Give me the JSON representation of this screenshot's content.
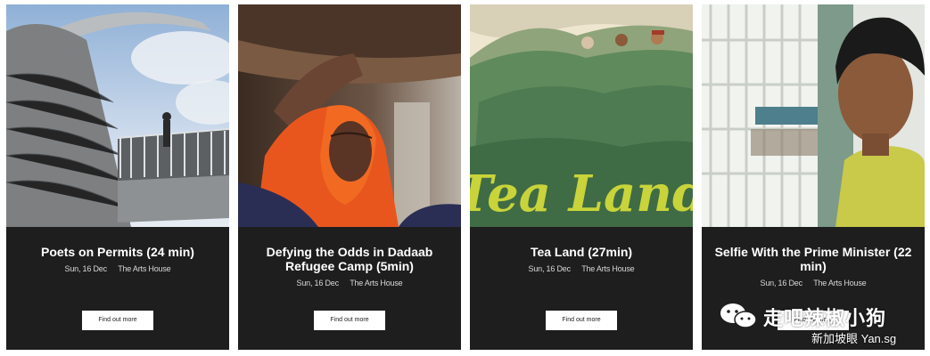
{
  "cards": [
    {
      "title": "Poets on Permits (24 min)",
      "date": "Sun, 16 Dec",
      "venue": "The Arts House",
      "button": "Find out more"
    },
    {
      "title": "Defying the Odds in Dadaab Refugee Camp (5min)",
      "date": "Sun, 16 Dec",
      "venue": "The Arts House",
      "button": "Find out more"
    },
    {
      "title": "Tea Land (27min)",
      "date": "Sun, 16 Dec",
      "venue": "The Arts House",
      "button": "Find out more",
      "poster_text": "Tea Land"
    },
    {
      "title": "Selfie With the Prime Minister (22 min)",
      "date": "Sun, 16 Dec",
      "venue": "The Arts House",
      "button": "Find out more"
    }
  ],
  "watermark": {
    "name": "走吧辣椒小狗",
    "sub": "新加坡眼 Yan.sg",
    "icon": "wechat-icon"
  },
  "colors": {
    "card_bg": "#1e1e1e",
    "button_bg": "#ffffff",
    "poster_text": "#c9d43a"
  }
}
